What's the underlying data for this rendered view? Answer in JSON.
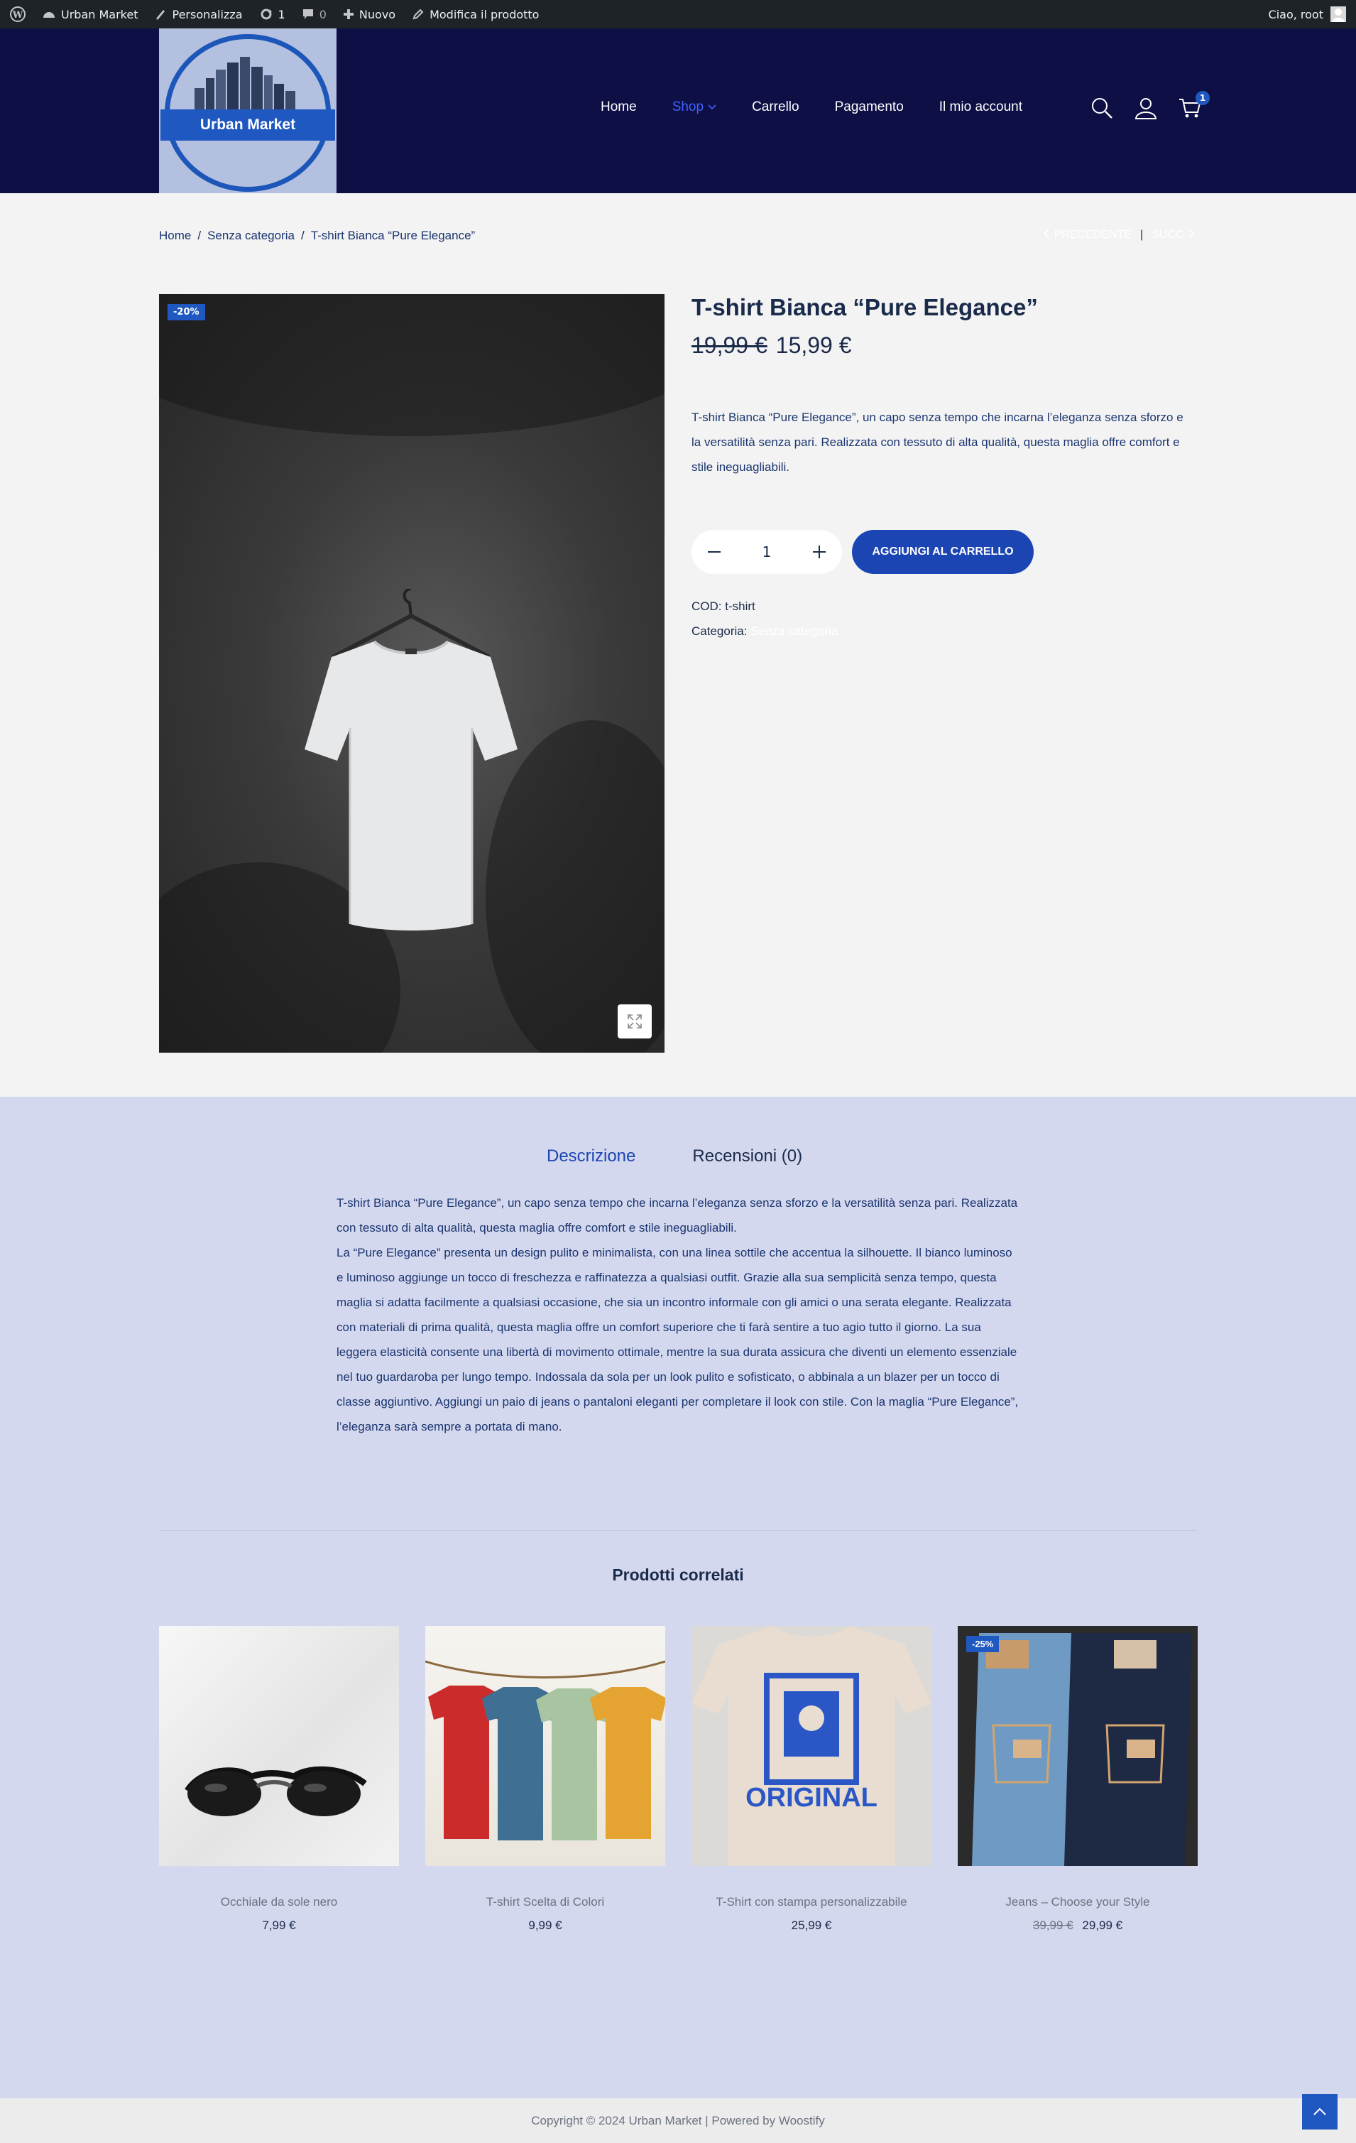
{
  "adminbar": {
    "site_name": "Urban Market",
    "customize": "Personalizza",
    "updates_count": "1",
    "comments_count": "0",
    "new": "Nuovo",
    "edit_product": "Modifica il prodotto",
    "greeting": "Ciao, root"
  },
  "header": {
    "logo_text": "Urban Market",
    "nav": [
      "Home",
      "Shop",
      "Carrello",
      "Pagamento",
      "Il mio account"
    ],
    "cart_count": "1"
  },
  "breadcrumb": [
    "Home",
    "Senza categoria",
    "T-shirt Bianca “Pure Elegance”"
  ],
  "product_nav": {
    "prev": "PRECEDENTE",
    "next": "SUCC"
  },
  "product": {
    "sale_badge": "-20%",
    "title": "T-shirt Bianca “Pure Elegance”",
    "old_price": "19,99 €",
    "price": "15,99 €",
    "short_description": "T-shirt Bianca “Pure Elegance”, un capo senza tempo che incarna l’eleganza senza sforzo e la versatilità senza pari. Realizzata con tessuto di alta qualità, questa maglia offre comfort e stile ineguagliabili.",
    "quantity": "1",
    "add_to_cart": "AGGIUNGI AL CARRELLO",
    "sku_label": "COD:",
    "sku": "t-shirt",
    "category_label": "Categoria:",
    "category": "Senza categoria"
  },
  "tabs": [
    "Descrizione",
    "Recensioni (0)"
  ],
  "description": [
    "T-shirt Bianca “Pure Elegance”, un capo senza tempo che incarna l’eleganza senza sforzo e la versatilità senza pari. Realizzata con tessuto di alta qualità, questa maglia offre comfort e stile ineguagliabili.",
    "La “Pure Elegance” presenta un design pulito e minimalista, con una linea sottile che accentua la silhouette. Il bianco luminoso e luminoso aggiunge un tocco di freschezza e raffinatezza a qualsiasi outfit. Grazie alla sua semplicità senza tempo, questa maglia si adatta facilmente a qualsiasi occasione, che sia un incontro informale con gli amici o una serata elegante. Realizzata con materiali di prima qualità, questa maglia offre un comfort superiore che ti farà sentire a tuo agio tutto il giorno. La sua leggera elasticità consente una libertà di movimento ottimale, mentre la sua durata assicura che diventi un elemento essenziale nel tuo guardaroba per lungo tempo. Indossala da sola per un look pulito e sofisticato, o abbinala a un blazer per un tocco di classe aggiuntivo. Aggiungi un paio di jeans o pantaloni eleganti per completare il look con stile. Con la maglia “Pure Elegance”, l’eleganza sarà sempre a portata di mano."
  ],
  "related": {
    "title": "Prodotti correlati",
    "items": [
      {
        "name": "Occhiale da sole nero",
        "price": "7,99 €"
      },
      {
        "name": "T-shirt Scelta di Colori",
        "price": "9,99 €"
      },
      {
        "name": "T-Shirt con stampa personalizzabile",
        "price": "25,99 €"
      },
      {
        "name": "Jeans – Choose your Style",
        "old_price": "39,99 €",
        "price": "29,99 €",
        "badge": "-25%"
      }
    ],
    "print_text": "ORIGINAL"
  },
  "footer": {
    "copyright": "Copyright © 2024 Urban Market | Powered by Woostify"
  },
  "colors": {
    "accent": "#1f58c0",
    "header_bg": "#0e0f45",
    "lower_bg": "#d4d8ee"
  }
}
